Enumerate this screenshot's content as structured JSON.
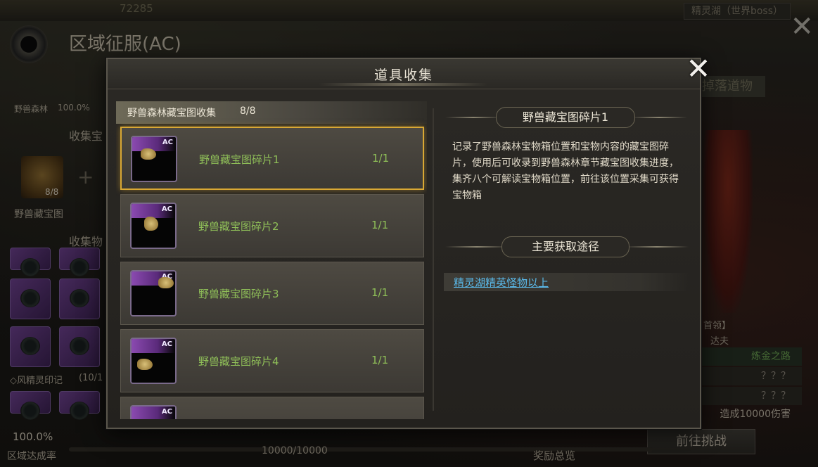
{
  "background": {
    "top_left_text": "",
    "top_mid_text": "72285",
    "boss_label": "精灵湖（世界boss）",
    "page_title": "区域征服(AC)",
    "left": {
      "forest_label": "野兽森林",
      "forest_percent": "100.0%",
      "collect_treasure": "收集宝",
      "map_count": "8/8",
      "map_label": "野兽藏宝图",
      "collect_items": "收集物",
      "wind_seal": "◇风精灵印记",
      "wind_seal_count": "(10/1",
      "completion_percent": "100.0%",
      "completion_label": "区域达成率"
    },
    "right": {
      "drop_label": "掉落道物",
      "leader_label": "首领】",
      "leader_name": "达夫",
      "alchemy_road": "炼金之路",
      "unknown1": "？？？",
      "unknown2": "？？？",
      "damage_text": "造成10000伤害",
      "challenge_button": "前往挑战"
    },
    "bottom": {
      "progress_text": "10000/10000",
      "reward_overview": "奖励总览"
    }
  },
  "modal": {
    "title": "道具收集",
    "close_icon": "close-icon",
    "list_header": {
      "name": "野兽森林藏宝图收集",
      "count": "8/8"
    },
    "items": [
      {
        "name": "野兽藏宝图碎片1",
        "count": "1/1",
        "badge": "AC",
        "selected": true
      },
      {
        "name": "野兽藏宝图碎片2",
        "count": "1/1",
        "badge": "AC",
        "selected": false
      },
      {
        "name": "野兽藏宝图碎片3",
        "count": "1/1",
        "badge": "AC",
        "selected": false
      },
      {
        "name": "野兽藏宝图碎片4",
        "count": "1/1",
        "badge": "AC",
        "selected": false
      },
      {
        "name": "",
        "count": "",
        "badge": "AC",
        "selected": false
      }
    ],
    "detail": {
      "title": "野兽藏宝图碎片1",
      "description": "记录了野兽森林宝物箱位置和宝物内容的藏宝图碎片，使用后可收录到野兽森林章节藏宝图收集进度，集齐八个可解读宝物箱位置，前往该位置采集可获得宝物箱",
      "route_title": "主要获取途径",
      "route_link": "精灵湖精英怪物以上"
    }
  },
  "colors": {
    "selected_border": "#d9a834",
    "item_text": "#8fbf58",
    "link": "#5ab8e8",
    "rarity_purple": "#8a4ab0"
  }
}
